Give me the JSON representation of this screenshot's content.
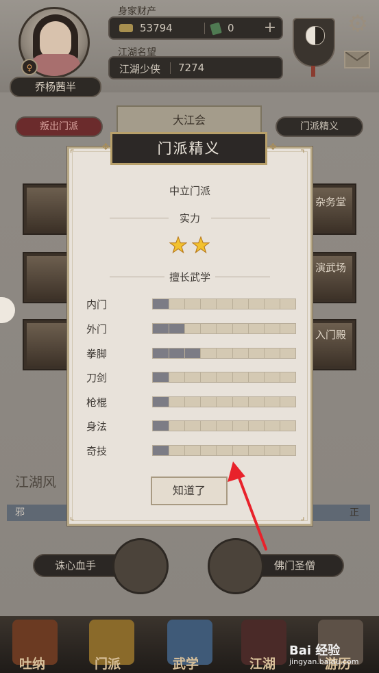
{
  "player": {
    "name": "乔杨茜半",
    "gender_symbol": "♀"
  },
  "resources": {
    "label": "身家财产",
    "gold": "53794",
    "jade": "0",
    "plus": "+"
  },
  "reputation": {
    "label": "江湖名望",
    "title": "江湖少侠",
    "value": "7274"
  },
  "top_actions": {
    "betray": "叛出门派",
    "sect_name": "大江会",
    "sect_info": "门派精义"
  },
  "halls": [
    {
      "label": "杂务堂"
    },
    {
      "label": "演武场"
    },
    {
      "label": "入门殿"
    }
  ],
  "world": {
    "fengyun": "江湖风",
    "faction_left": "邪",
    "faction_right": "正"
  },
  "chiefs": {
    "left": "诛心血手",
    "right": "佛门圣僧"
  },
  "nav": [
    {
      "label": "吐纳",
      "icon": "breathing-icon"
    },
    {
      "label": "门派",
      "icon": "sect-flag-icon"
    },
    {
      "label": "武学",
      "icon": "martial-book-icon"
    },
    {
      "label": "江湖",
      "icon": "hat-icon"
    },
    {
      "label": "游历",
      "icon": "travel-icon"
    }
  ],
  "modal": {
    "title": "门派精义",
    "sect_type": "中立门派",
    "strength_label": "实力",
    "strength_stars": 2,
    "skills_label": "擅长武学",
    "skills": [
      {
        "label": "内门",
        "level": 1
      },
      {
        "label": "外门",
        "level": 2
      },
      {
        "label": "拳脚",
        "level": 3
      },
      {
        "label": "刀剑",
        "level": 1
      },
      {
        "label": "枪棍",
        "level": 1
      },
      {
        "label": "身法",
        "level": 1
      },
      {
        "label": "奇技",
        "level": 1
      }
    ],
    "max_level": 9,
    "confirm": "知道了"
  },
  "watermark": {
    "brand": "Bai 经验",
    "url": "jingyan.baidu.com"
  },
  "colors": {
    "bar_fill": "#7c7c85",
    "bar_track": "#d4c9b3",
    "star": "#f2c12e",
    "arrow": "#e8222b"
  }
}
